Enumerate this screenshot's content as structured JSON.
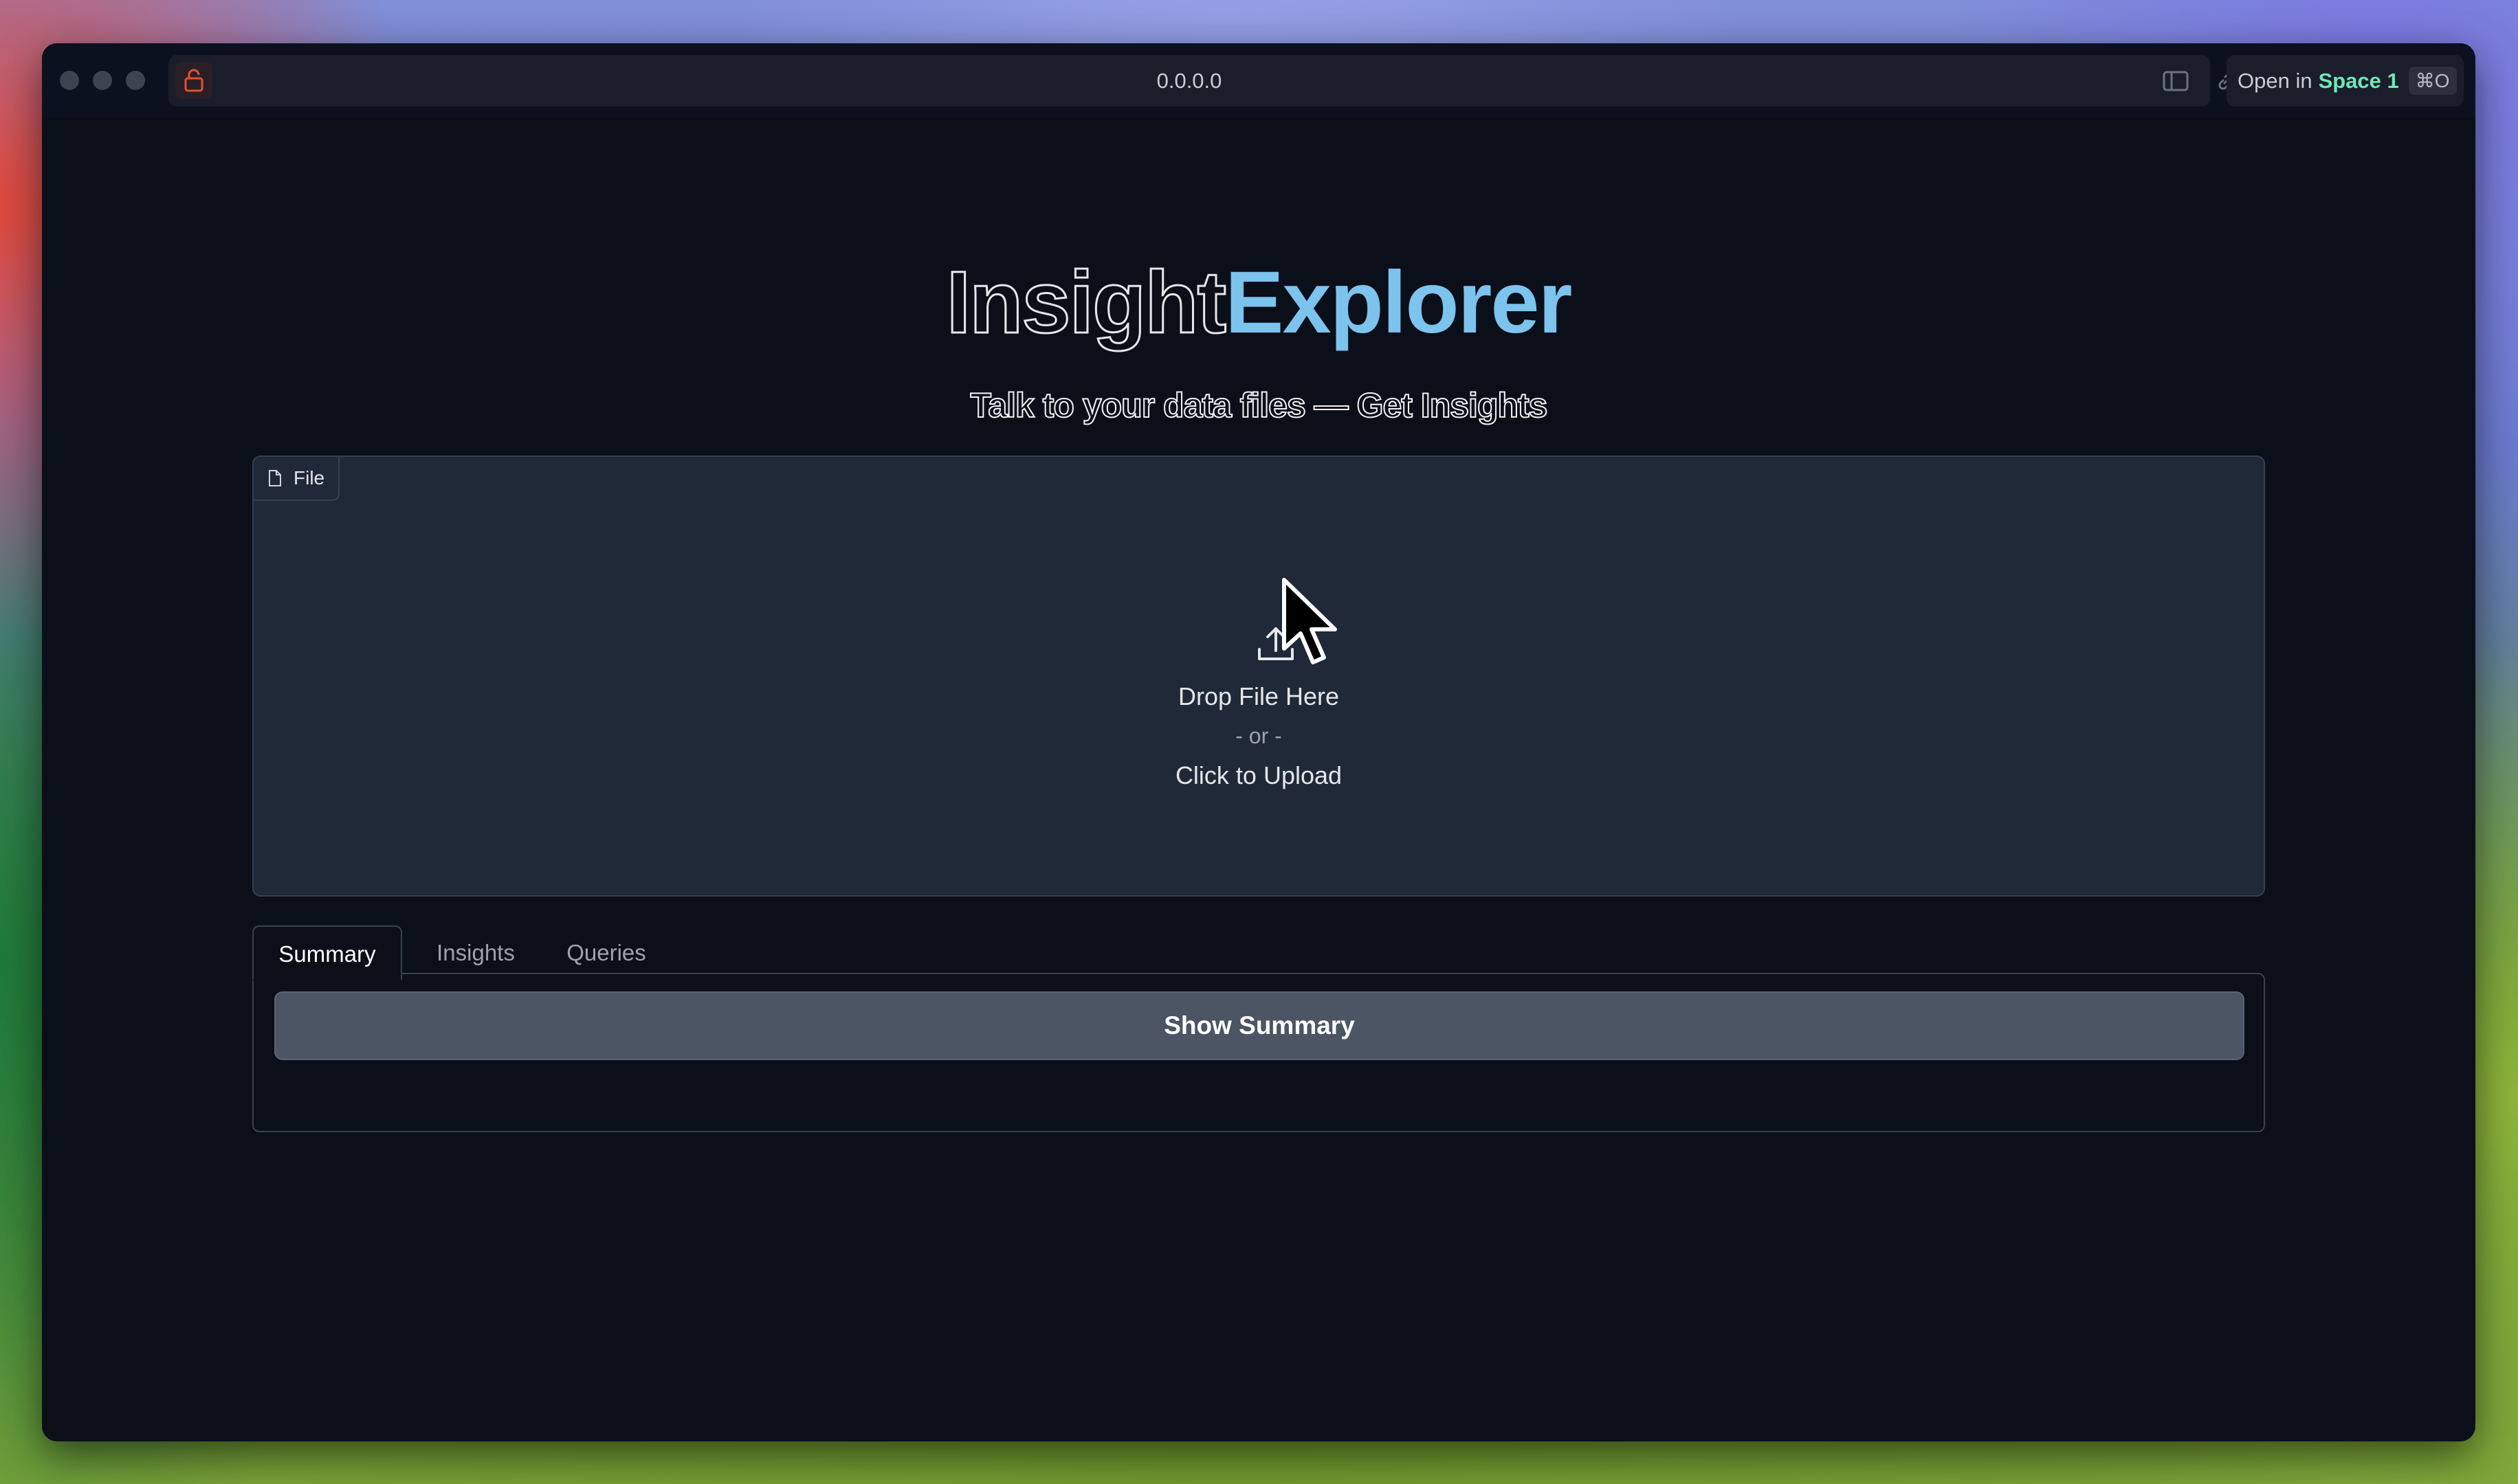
{
  "browser": {
    "url": "0.0.0.0",
    "open_in_label": "Open in",
    "open_in_space": "Space 1",
    "open_in_shortcut": "⌘O"
  },
  "app": {
    "title_part1": "Insight",
    "title_part2": "Explorer",
    "subtitle": "Talk to your data files — Get Insights"
  },
  "file_upload": {
    "tag_label": "File",
    "drop_text": "Drop File Here",
    "or_text": "- or -",
    "click_text": "Click to Upload"
  },
  "tabs": [
    {
      "label": "Summary",
      "active": true
    },
    {
      "label": "Insights",
      "active": false
    },
    {
      "label": "Queries",
      "active": false
    }
  ],
  "summary_panel": {
    "button_label": "Show Summary"
  },
  "colors": {
    "accent_title": "#7cc3ee",
    "background": "#0b0f19",
    "panel": "#1f2937",
    "button": "#4b5563",
    "lock_icon": "#e0532f"
  }
}
